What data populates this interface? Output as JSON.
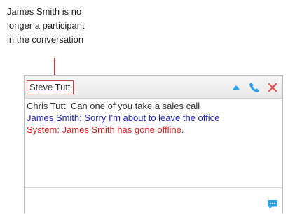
{
  "callout": {
    "lines": [
      "James Smith is no",
      "longer a participant",
      "in the conversation"
    ]
  },
  "chat": {
    "title": "Steve Tutt",
    "icons": [
      "caret-up-icon",
      "phone-icon",
      "close-icon",
      "chat-bubble-icon"
    ],
    "messages": [
      {
        "text": "Chris Tutt: Can one of you take a sales call",
        "color": "#333333"
      },
      {
        "text": "James Smith: Sorry I'm about to leave the office",
        "color": "#1f1fb8"
      },
      {
        "text": "System: James Smith has gone offline.",
        "color": "#d51b1b"
      }
    ],
    "input_value": ""
  },
  "colors": {
    "accent": "#2ea0e6",
    "callout_line": "#d33a3a",
    "close": "#e05a5a"
  }
}
